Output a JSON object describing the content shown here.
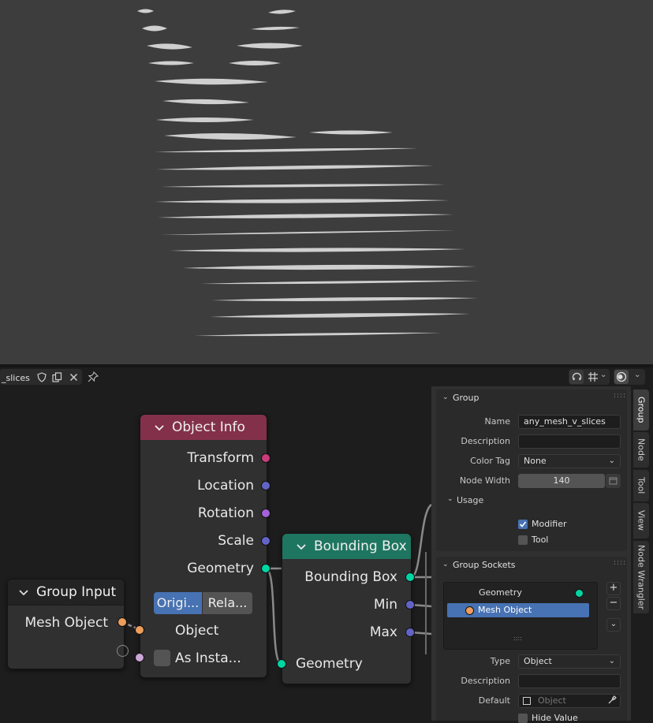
{
  "header": {
    "tree_name": "_slices"
  },
  "nodes": {
    "object_info": {
      "title": "Object Info",
      "outputs": [
        "Transform",
        "Location",
        "Rotation",
        "Scale",
        "Geometry"
      ],
      "buttons": [
        "Origi...",
        "Rela..."
      ],
      "inputs": [
        "Object",
        "As Insta..."
      ],
      "header_color": "#83314a"
    },
    "bounding_box": {
      "title": "Bounding Box",
      "outputs": [
        "Bounding Box",
        "Min",
        "Max"
      ],
      "input": "Geometry",
      "header_color": "#1e7560"
    },
    "group_input": {
      "title": "Group Input",
      "output": "Mesh Object"
    }
  },
  "sidebar": {
    "group_panel": {
      "title": "Group",
      "name_label": "Name",
      "name_value": "any_mesh_v_slices",
      "description_label": "Description",
      "description_value": "",
      "color_tag_label": "Color Tag",
      "color_tag_value": "None",
      "node_width_label": "Node Width",
      "node_width_value": "140",
      "usage_title": "Usage",
      "modifier_label": "Modifier",
      "modifier_checked": true,
      "tool_label": "Tool",
      "tool_checked": false
    },
    "sockets_panel": {
      "title": "Group Sockets",
      "items": [
        "Geometry",
        "Mesh Object"
      ],
      "type_label": "Type",
      "type_value": "Object",
      "description_label": "Description",
      "description_value": "",
      "default_label": "Default",
      "default_placeholder": "Object",
      "hide_value_label": "Hide Value"
    },
    "tabs": [
      "Group",
      "Node",
      "Tool",
      "View",
      "Node Wrangler"
    ]
  },
  "colors": {
    "geometry_socket": "#00d6a3",
    "vector_socket": "#6363c7",
    "rotation_socket": "#a363d6",
    "matrix_socket": "#c93d7b",
    "object_socket": "#ed9e5c",
    "boolean_socket": "#cca6d6",
    "selection": "#4772b3"
  }
}
